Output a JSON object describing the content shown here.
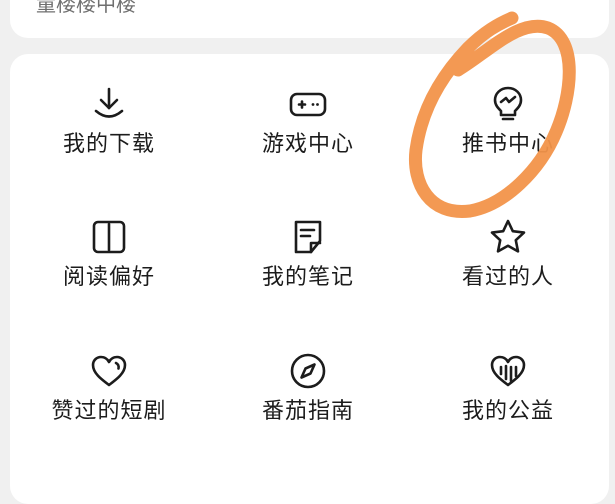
{
  "top_card": {
    "partial_text": "童楼楼中楼"
  },
  "colors": {
    "icon_stroke": "#1c1c1c",
    "label": "#1c1c1c",
    "annotation": "#f2944a",
    "panel": "#ffffff",
    "background": "#f0f0f0"
  },
  "menu": {
    "items": [
      {
        "label": "我的下载",
        "icon": "download-icon"
      },
      {
        "label": "游戏中心",
        "icon": "gamepad-icon"
      },
      {
        "label": "推书中心",
        "icon": "lightbulb-icon"
      },
      {
        "label": "阅读偏好",
        "icon": "book-icon"
      },
      {
        "label": "我的笔记",
        "icon": "note-icon"
      },
      {
        "label": "看过的人",
        "icon": "star-icon"
      },
      {
        "label": "赞过的短剧",
        "icon": "heart-icon"
      },
      {
        "label": "番茄指南",
        "icon": "compass-icon"
      },
      {
        "label": "我的公益",
        "icon": "charity-heart-icon"
      }
    ]
  }
}
